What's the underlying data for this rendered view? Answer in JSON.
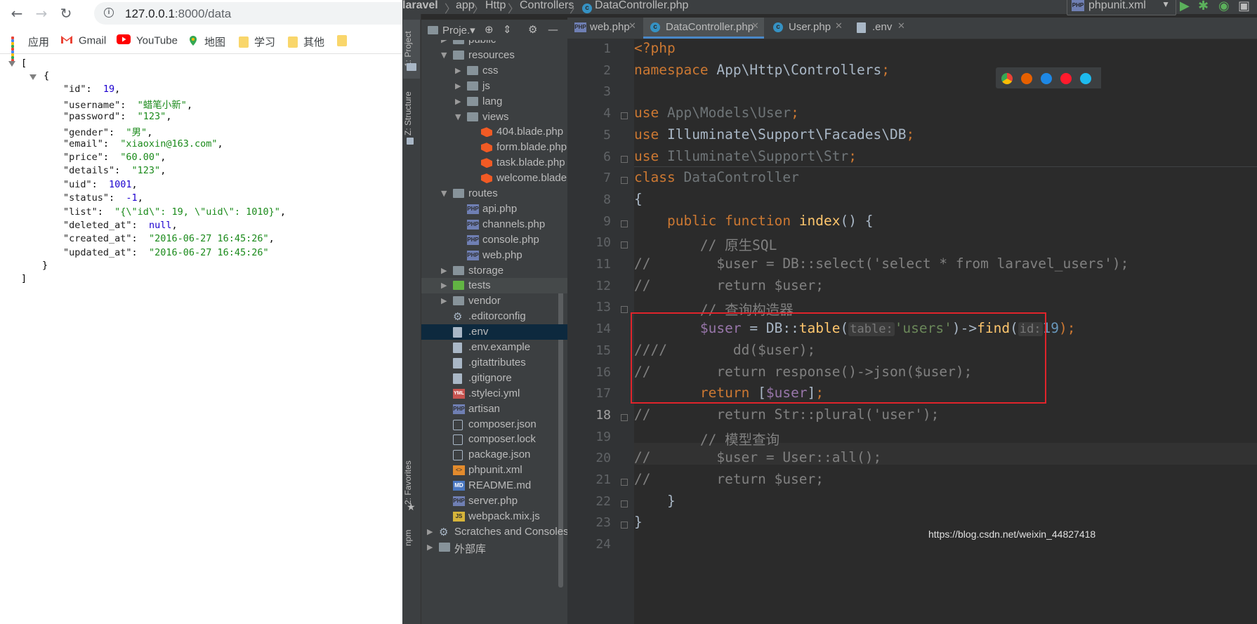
{
  "browser": {
    "url_host": "127.0.0.1",
    "url_path": ":8000/data",
    "bookmarks": [
      "应用",
      "Gmail",
      "YouTube",
      "地图",
      "学习",
      "其他"
    ],
    "json_lines": {
      "open_bracket": "[",
      "open_brace": "{",
      "close_brace": "}",
      "close_bracket": "]"
    },
    "record": [
      {
        "key": "\"id\"",
        "value": "19",
        "type": "num"
      },
      {
        "key": "\"username\"",
        "value": "\"蜡笔小新\"",
        "type": "str"
      },
      {
        "key": "\"password\"",
        "value": "\"123\"",
        "type": "str"
      },
      {
        "key": "\"gender\"",
        "value": "\"男\"",
        "type": "str"
      },
      {
        "key": "\"email\"",
        "value": "\"xiaoxin@163.com\"",
        "type": "str"
      },
      {
        "key": "\"price\"",
        "value": "\"60.00\"",
        "type": "str"
      },
      {
        "key": "\"details\"",
        "value": "\"123\"",
        "type": "str"
      },
      {
        "key": "\"uid\"",
        "value": "1001",
        "type": "num"
      },
      {
        "key": "\"status\"",
        "value": "-1",
        "type": "num"
      },
      {
        "key": "\"list\"",
        "value": "\"{\\\"id\\\": 19, \\\"uid\\\": 1010}\"",
        "type": "str"
      },
      {
        "key": "\"deleted_at\"",
        "value": "null",
        "type": "null"
      },
      {
        "key": "\"created_at\"",
        "value": "\"2016-06-27 16:45:26\"",
        "type": "str"
      },
      {
        "key": "\"updated_at\"",
        "value": "\"2016-06-27 16:45:26\"",
        "type": "str",
        "last": true
      }
    ]
  },
  "ide": {
    "breadcrumb": [
      "laravel",
      "app",
      "Http",
      "Controllers",
      "DataController.php"
    ],
    "run_config": "phpunit.xml",
    "side_tabs": {
      "project": "1: Project",
      "structure": "Z: Structure",
      "favorites": "2: Favorites",
      "npm": "npm"
    },
    "project_label": "Proje.▾",
    "tabs": [
      {
        "label": "web.php",
        "icon": "php-icon"
      },
      {
        "label": "DataController.php",
        "icon": "class-icon",
        "active": true
      },
      {
        "label": "User.php",
        "icon": "class-icon"
      },
      {
        "label": ".env",
        "icon": "text-file-icon"
      }
    ],
    "tree": [
      {
        "name": "public",
        "indent": 1,
        "arrow": "▶",
        "icon": "folder"
      },
      {
        "name": "resources",
        "indent": 1,
        "arrow": "▼",
        "icon": "folder"
      },
      {
        "name": "css",
        "indent": 2,
        "arrow": "▶",
        "icon": "folder"
      },
      {
        "name": "js",
        "indent": 2,
        "arrow": "▶",
        "icon": "folder"
      },
      {
        "name": "lang",
        "indent": 2,
        "arrow": "▶",
        "icon": "folder"
      },
      {
        "name": "views",
        "indent": 2,
        "arrow": "▼",
        "icon": "folder"
      },
      {
        "name": "404.blade.php",
        "indent": 3,
        "icon": "blade"
      },
      {
        "name": "form.blade.php",
        "indent": 3,
        "icon": "blade"
      },
      {
        "name": "task.blade.php",
        "indent": 3,
        "icon": "blade"
      },
      {
        "name": "welcome.blade.p",
        "indent": 3,
        "icon": "blade"
      },
      {
        "name": "routes",
        "indent": 1,
        "arrow": "▼",
        "icon": "folder"
      },
      {
        "name": "api.php",
        "indent": 2,
        "icon": "php"
      },
      {
        "name": "channels.php",
        "indent": 2,
        "icon": "php"
      },
      {
        "name": "console.php",
        "indent": 2,
        "icon": "php"
      },
      {
        "name": "web.php",
        "indent": 2,
        "icon": "php"
      },
      {
        "name": "storage",
        "indent": 1,
        "arrow": "▶",
        "icon": "folder"
      },
      {
        "name": "tests",
        "indent": 1,
        "arrow": "▶",
        "icon": "folder-green",
        "hl": true
      },
      {
        "name": "vendor",
        "indent": 1,
        "arrow": "▶",
        "icon": "folder"
      },
      {
        "name": ".editorconfig",
        "indent": 1,
        "icon": "gear"
      },
      {
        "name": ".env",
        "indent": 1,
        "icon": "txt",
        "sel": true
      },
      {
        "name": ".env.example",
        "indent": 1,
        "icon": "txt"
      },
      {
        "name": ".gitattributes",
        "indent": 1,
        "icon": "txt"
      },
      {
        "name": ".gitignore",
        "indent": 1,
        "icon": "txt"
      },
      {
        "name": ".styleci.yml",
        "indent": 1,
        "icon": "yml"
      },
      {
        "name": "artisan",
        "indent": 1,
        "icon": "php"
      },
      {
        "name": "composer.json",
        "indent": 1,
        "icon": "lock"
      },
      {
        "name": "composer.lock",
        "indent": 1,
        "icon": "lock"
      },
      {
        "name": "package.json",
        "indent": 1,
        "icon": "lock"
      },
      {
        "name": "phpunit.xml",
        "indent": 1,
        "icon": "xml"
      },
      {
        "name": "README.md",
        "indent": 1,
        "icon": "md"
      },
      {
        "name": "server.php",
        "indent": 1,
        "icon": "php"
      },
      {
        "name": "webpack.mix.js",
        "indent": 1,
        "icon": "js"
      },
      {
        "name": "Scratches and Consoles",
        "indent": 0,
        "arrow": "▶",
        "icon": "scratch"
      },
      {
        "name": "外部库",
        "indent": 0,
        "arrow": "▶",
        "icon": "lib"
      }
    ],
    "line_numbers": [
      "1",
      "2",
      "3",
      "4",
      "5",
      "6",
      "7",
      "8",
      "9",
      "10",
      "11",
      "12",
      "13",
      "14",
      "15",
      "16",
      "17",
      "18",
      "19",
      "20",
      "21",
      "22",
      "23",
      "24"
    ],
    "current_line": "18",
    "code": [
      [
        [
          "k",
          "<?php"
        ]
      ],
      [
        [
          "k",
          "namespace "
        ],
        [
          "p",
          "App\\Http\\Controllers"
        ],
        [
          "k",
          ";"
        ]
      ],
      [],
      [
        [
          "k",
          "use "
        ],
        [
          "g",
          "App\\Models\\User"
        ],
        [
          "k",
          ";"
        ]
      ],
      [
        [
          "k",
          "use "
        ],
        [
          "p",
          "Illuminate\\Support\\Facades\\DB"
        ],
        [
          "k",
          ";"
        ]
      ],
      [
        [
          "k",
          "use "
        ],
        [
          "g",
          "Illuminate\\Support\\Str"
        ],
        [
          "k",
          ";"
        ]
      ],
      [
        [
          "k",
          "class "
        ],
        [
          "g",
          "DataController"
        ]
      ],
      [
        [
          "p",
          "{"
        ]
      ],
      [
        [
          "p",
          "    "
        ],
        [
          "k",
          "public function "
        ],
        [
          "f",
          "index"
        ],
        [
          "p",
          "() {"
        ]
      ],
      [
        [
          "p",
          "        "
        ],
        [
          "c",
          "// 原生SQL"
        ]
      ],
      [
        [
          "c",
          "//        $user = DB::select('select * from laravel_users');"
        ]
      ],
      [
        [
          "c",
          "//        return $user;"
        ]
      ],
      [
        [
          "p",
          "        "
        ],
        [
          "c",
          "// 查询构造器"
        ]
      ],
      [
        [
          "p",
          "        "
        ],
        [
          "v",
          "$user"
        ],
        [
          "p",
          " = DB::"
        ],
        [
          "f",
          "table"
        ],
        [
          "p",
          "("
        ],
        [
          "h",
          "table:"
        ],
        [
          "s",
          "'users'"
        ],
        [
          "p",
          ")->"
        ],
        [
          "f",
          "find"
        ],
        [
          "p",
          "("
        ],
        [
          "h",
          "id:"
        ],
        [
          "n",
          "19"
        ],
        [
          "k",
          ");"
        ]
      ],
      [
        [
          "c",
          "////        dd($user);"
        ]
      ],
      [
        [
          "c",
          "//        return response()->json($user);"
        ]
      ],
      [
        [
          "p",
          "        "
        ],
        [
          "k",
          "return "
        ],
        [
          "p",
          "["
        ],
        [
          "v",
          "$user"
        ],
        [
          "p",
          "]"
        ],
        [
          "k",
          ";"
        ]
      ],
      [
        [
          "c",
          "//        return Str::plural('user');"
        ]
      ],
      [
        [
          "p",
          "        "
        ],
        [
          "c",
          "// 模型查询"
        ]
      ],
      [
        [
          "c",
          "//        $user = User::all();"
        ]
      ],
      [
        [
          "c",
          "//        return $user;"
        ]
      ],
      [
        [
          "p",
          "    }"
        ]
      ],
      [
        [
          "p",
          "}"
        ]
      ],
      []
    ],
    "watermark": "https://blog.csdn.net/weixin_44827418"
  }
}
